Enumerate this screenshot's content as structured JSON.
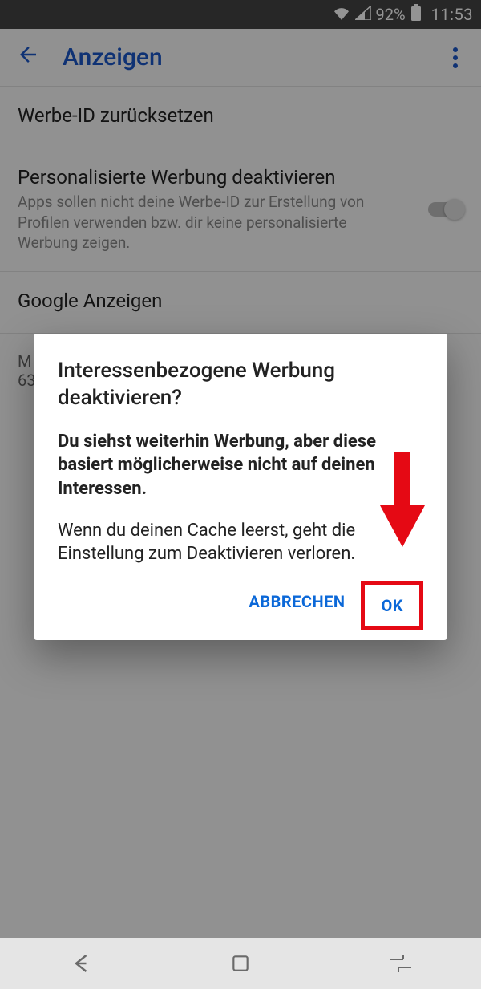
{
  "status": {
    "battery": "92%",
    "time": "11:53"
  },
  "appbar": {
    "title": "Anzeigen"
  },
  "rows": {
    "reset": {
      "title": "Werbe-ID zurücksetzen"
    },
    "optout": {
      "title": "Personalisierte Werbung deaktivieren",
      "sub": "Apps sollen nicht deine Werbe-ID zur Erstellung von Profilen verwenden bzw. dir keine personalisierte Werbung zeigen."
    },
    "google_ads": {
      "title": "Google Anzeigen"
    }
  },
  "partial_line1": "M",
  "partial_line2": "63",
  "dialog": {
    "title": "Interessenbezogene Werbung deaktivieren?",
    "bold": "Du siehst weiterhin Werbung, aber diese basiert möglicherweise nicht auf deinen Interessen.",
    "plain": "Wenn du deinen Cache leerst, geht die Einstellung zum Deaktivieren verloren.",
    "cancel": "ABBRECHEN",
    "ok": "OK"
  }
}
